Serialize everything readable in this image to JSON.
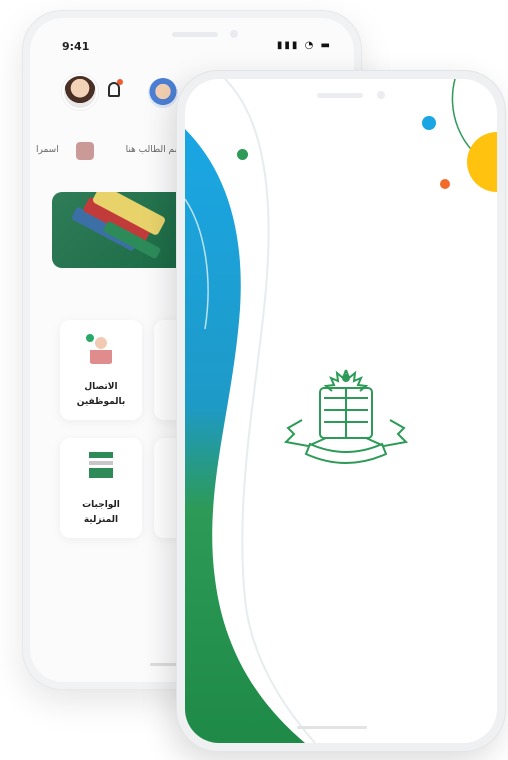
{
  "back_screen": {
    "status_time": "9:41",
    "student_prefix": "سم الطالب هنا",
    "student_name": "اسمرا",
    "cards": [
      {
        "label_line1": "الاتصال",
        "label_line2": "بالموظفين",
        "icon": "staff-icon"
      },
      {
        "label_line1": "الواجبات",
        "label_line2": "المنزلية",
        "icon": "homework-icon"
      }
    ]
  },
  "front_screen": {
    "logo_icon": "school-crest-logo",
    "colors": {
      "green": "#2d9a57",
      "blue": "#1aa6e4",
      "orange": "#f36b2b",
      "yellow": "#ffc20e"
    }
  }
}
